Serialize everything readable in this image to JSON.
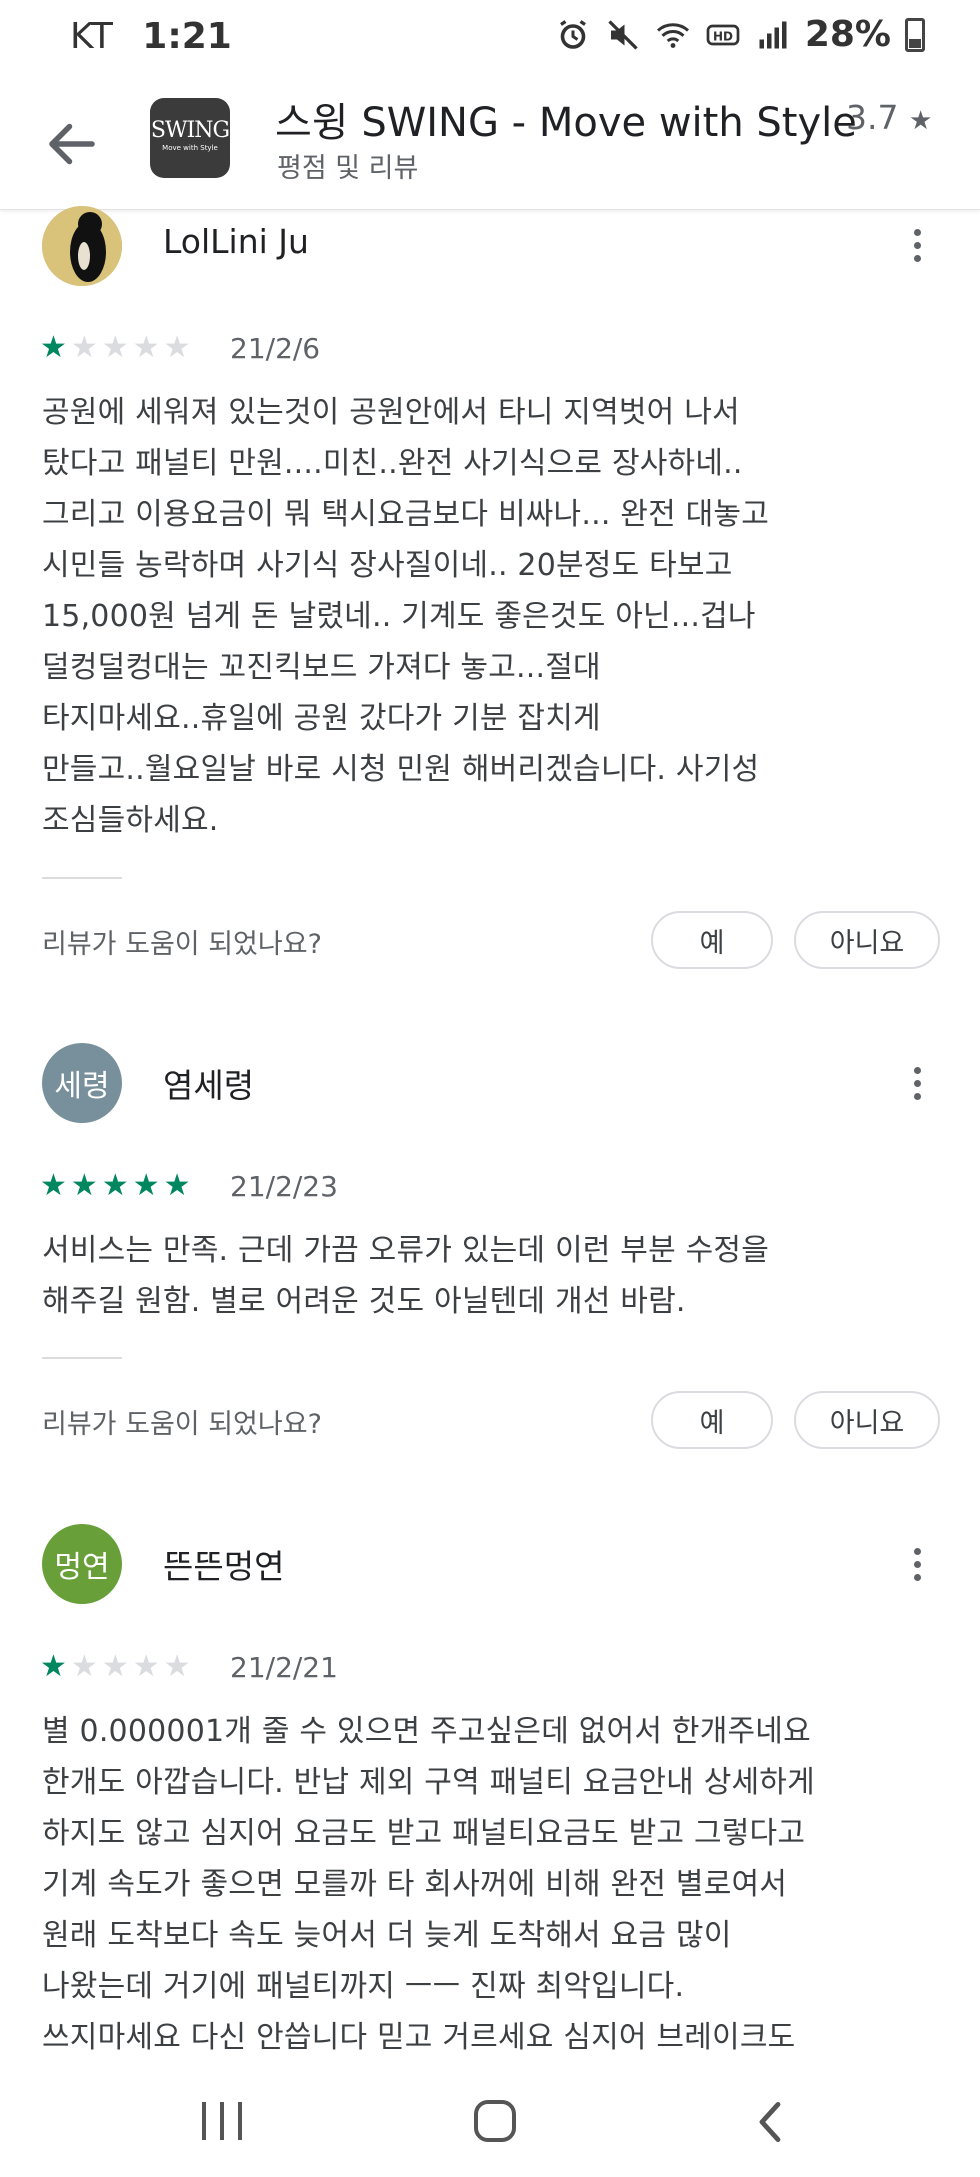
{
  "status_bar": {
    "carrier": "KT",
    "time": "1:21",
    "battery": "28%"
  },
  "app_bar": {
    "app_name": "스윙 SWING - Move with Style",
    "rating": "3.7",
    "rating_star": "★",
    "subtitle": "평점 및 리뷰",
    "icon_line1": "SWING",
    "icon_line2": "Move with Style"
  },
  "reviews": [
    {
      "name": "LolLini Ju",
      "avatar_text": "",
      "avatar_color": "#1a1a1a",
      "stars": 1,
      "date": "21/2/6",
      "text": "공원에 세워져 있는것이 공원안에서 타니 지역벗어 나서\n탔다고 패널티 만원....미친..완전 사기식으로 장사하네..\n그리고 이용요금이 뭐 택시요금보다 비싸나... 완전 대놓고\n시민들 농락하며 사기식 장사질이네.. 20분정도 타보고\n15,000원 넘게 돈 날렸네.. 기계도 좋은것도 아닌...겁나\n덜컹덜컹대는 꼬진킥보드 가져다 놓고...절대\n타지마세요..휴일에 공원 갔다가 기분 잡치게\n만들고..월요일날 바로 시청 민원 해버리겠습니다. 사기성\n조심들하세요.",
      "helpful_question": "리뷰가 도움이 되었나요?",
      "yes_label": "예",
      "no_label": "아니요"
    },
    {
      "name": "염세령",
      "avatar_text": "세령",
      "avatar_color": "#78909c",
      "stars": 5,
      "date": "21/2/23",
      "text": "서비스는 만족. 근데 가끔 오류가 있는데 이런 부분 수정을\n해주길 원함. 별로 어려운 것도 아닐텐데 개선 바람.",
      "helpful_question": "리뷰가 도움이 되었나요?",
      "yes_label": "예",
      "no_label": "아니요"
    },
    {
      "name": "뜬뜬멍연",
      "avatar_text": "멍연",
      "avatar_color": "#689f38",
      "stars": 1,
      "date": "21/2/21",
      "text": "별 0.000001개 줄 수 있으면 주고싶은데 없어서 한개주네요\n한개도 아깝습니다. 반납 제외 구역 패널티 요금안내 상세하게\n하지도 않고 심지어 요금도 받고 패널티요금도 받고 그렇다고\n기계 속도가 좋으면 모를까 타 회사꺼에 비해 완전 별로여서\n원래 도착보다 속도 늦어서 더 늦게 도착해서 요금 많이\n나왔는데 거기에 패널티까지 ㅡㅡ 진짜 최악입니다.\n쓰지마세요 다신 안씁니다 믿고 거르세요 심지어 브레이크도"
    }
  ],
  "icons": {
    "back": "arrow-left-icon",
    "more": "more-vert-icon",
    "nav_recents": "recent-apps-icon",
    "nav_home": "home-icon",
    "nav_back": "chevron-left-icon"
  },
  "colors": {
    "star_on": "#01875f",
    "star_off": "#dadce0",
    "text_secondary": "#5f6368"
  }
}
